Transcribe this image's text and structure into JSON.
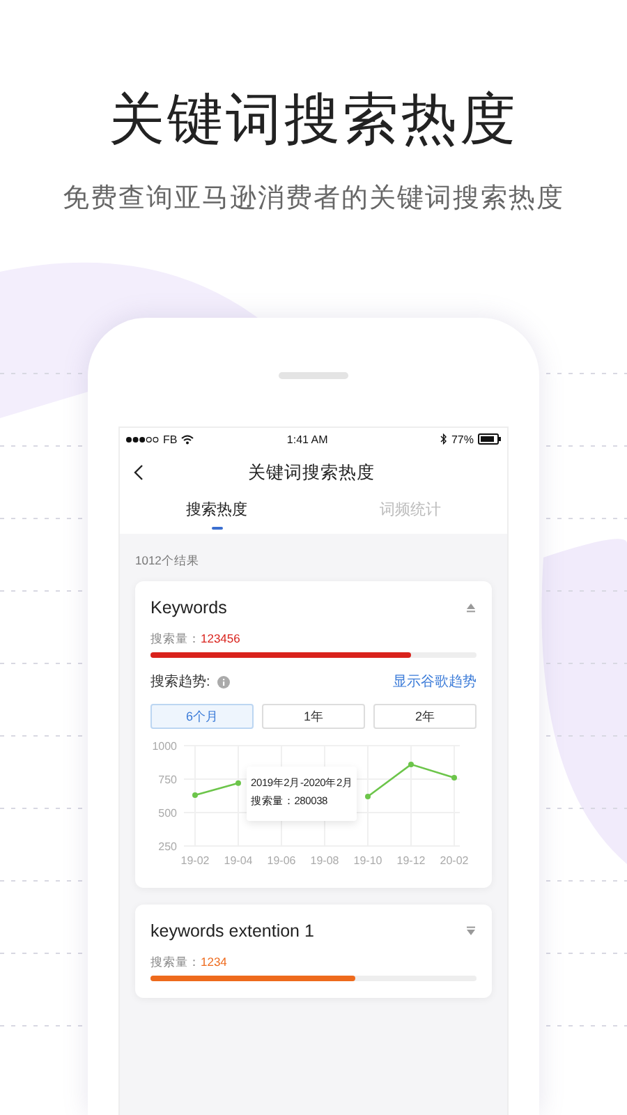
{
  "headline": "关键词搜索热度",
  "subheadline": "免费查询亚马逊消费者的关键词搜索热度",
  "status_bar": {
    "carrier": "FB",
    "time": "1:41 AM",
    "battery": "77%"
  },
  "nav": {
    "title": "关键词搜索热度"
  },
  "tabs": [
    {
      "label": "搜索热度",
      "selected": true
    },
    {
      "label": "词频统计",
      "selected": false
    }
  ],
  "result_count": "1012个结果",
  "cards": [
    {
      "title": "Keywords",
      "expanded": true,
      "volume_label": "搜索量：",
      "volume": "123456",
      "color": "#d9221c",
      "level": 0.8,
      "trend_label": "搜索趋势:",
      "trend_link": "显示谷歌趋势",
      "periods": [
        {
          "label": "6个月",
          "selected": true
        },
        {
          "label": "1年",
          "selected": false
        },
        {
          "label": "2年",
          "selected": false
        }
      ],
      "chart_data": {
        "type": "line",
        "categories": [
          "19-02",
          "19-04",
          "19-06",
          "19-08",
          "19-10",
          "19-12",
          "20-02"
        ],
        "series": [
          {
            "color": "#6cc54a",
            "marker": true,
            "values": [
              630,
              720,
              null,
              null,
              620,
              860,
              760
            ]
          }
        ],
        "ylim": [
          250,
          1000
        ],
        "yticks": [
          250,
          500,
          750,
          1000
        ],
        "grid": true
      },
      "tooltip": {
        "range": "2019年2月-2020年2月",
        "value": "搜索量：280038"
      }
    },
    {
      "title": "keywords extention 1",
      "expanded": false,
      "volume_label": "搜索量：",
      "volume": "1234",
      "color": "#ee6a1c",
      "level": 0.63
    }
  ]
}
